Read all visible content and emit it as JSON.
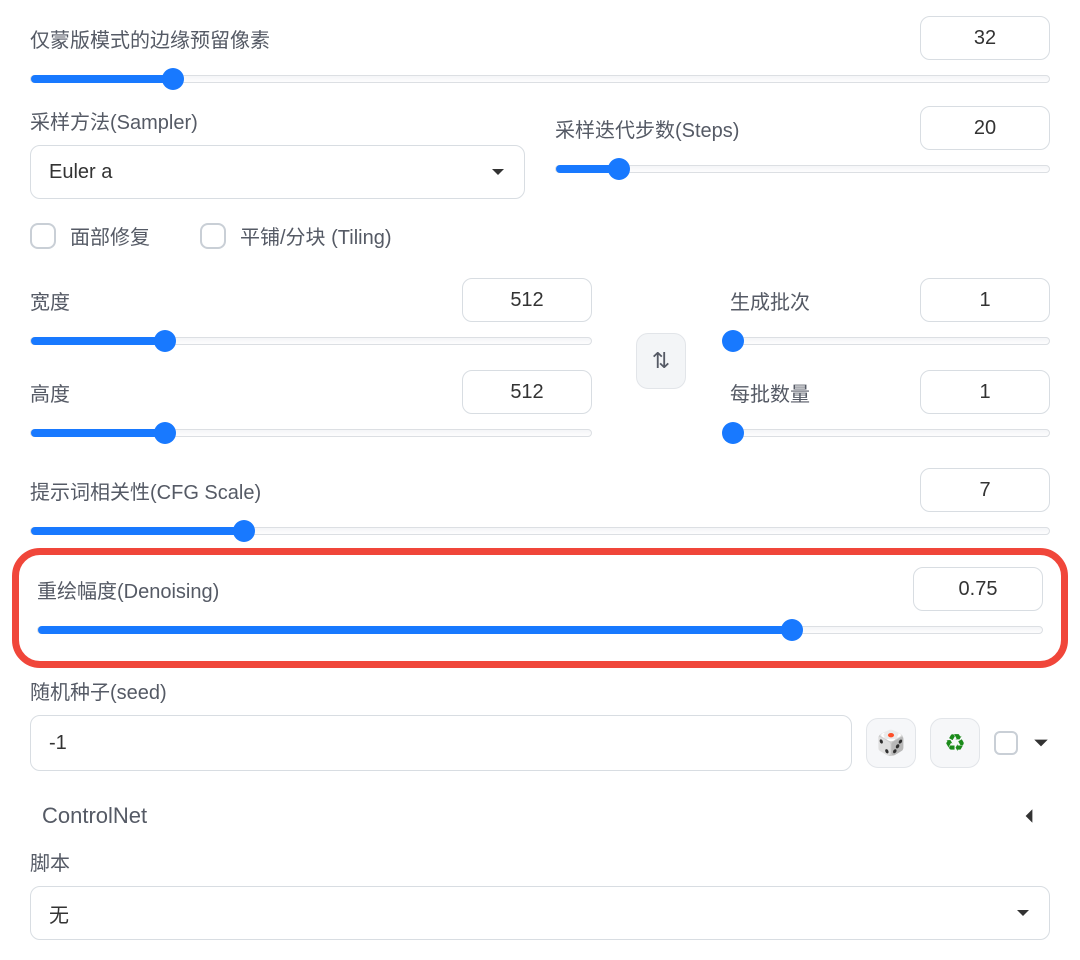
{
  "mask_padding": {
    "label": "仅蒙版模式的边缘预留像素",
    "value": "32",
    "pct": 14
  },
  "sampler": {
    "label": "采样方法(Sampler)",
    "selected": "Euler a"
  },
  "steps": {
    "label": "采样迭代步数(Steps)",
    "value": "20",
    "pct": 13
  },
  "face_restore": {
    "label": "面部修复"
  },
  "tiling": {
    "label": "平铺/分块 (Tiling)"
  },
  "width": {
    "label": "宽度",
    "value": "512",
    "pct": 24
  },
  "height": {
    "label": "高度",
    "value": "512",
    "pct": 24
  },
  "batch_count": {
    "label": "生成批次",
    "value": "1",
    "pct": 1
  },
  "batch_size": {
    "label": "每批数量",
    "value": "1",
    "pct": 1
  },
  "cfg": {
    "label": "提示词相关性(CFG Scale)",
    "value": "7",
    "pct": 21
  },
  "denoise": {
    "label": "重绘幅度(Denoising)",
    "value": "0.75",
    "pct": 75
  },
  "seed": {
    "label": "随机种子(seed)",
    "value": "-1"
  },
  "controlnet": {
    "label": "ControlNet"
  },
  "script": {
    "label": "脚本",
    "selected": "无"
  }
}
